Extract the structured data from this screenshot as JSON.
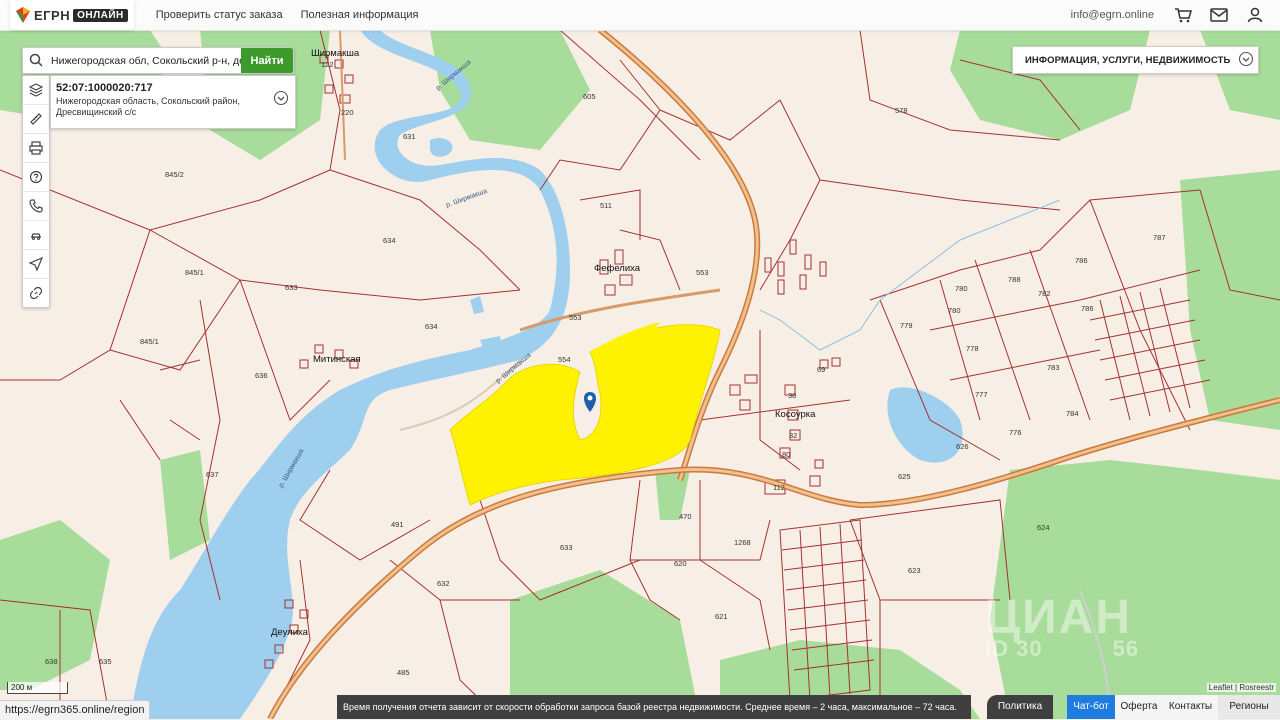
{
  "header": {
    "logo_text": "ЕГРН",
    "logo_badge": "ОНЛАЙН",
    "nav": [
      "Проверить статус заказа",
      "Полезная информация"
    ],
    "email": "info@egrn.online",
    "icons": [
      "cart-icon",
      "mail-icon",
      "user-icon"
    ]
  },
  "search": {
    "value": "Нижегородская обл, Сокольский р-н, дере",
    "button": "Найти"
  },
  "toolbar": [
    "layers-icon",
    "ruler-icon",
    "print-icon",
    "help-icon",
    "phone-icon",
    "auction-icon",
    "locate-icon",
    "link-icon"
  ],
  "parcel": {
    "cadastral_number": "52:07:1000020:717",
    "address_line1": "Нижегородская область, Сокольский район,",
    "address_line2": "Дресвищинский с/с"
  },
  "info_panel": {
    "label": "ИНФОРМАЦИЯ, УСЛУГИ, НЕДВИЖИМОСТЬ"
  },
  "map": {
    "places": [
      "Ширмакша",
      "Фефелиха",
      "Митинская",
      "Косоурка",
      "Деулиха"
    ],
    "rivers": [
      "р. Ширмакша",
      "р. Ширмакша",
      "р. Ширмакша",
      "р. Ширмакша"
    ],
    "plots": [
      "605",
      "578",
      "631",
      "122",
      "220",
      "845/2",
      "511",
      "634",
      "553",
      "845/1",
      "633",
      "634",
      "553",
      "554",
      "787",
      "786",
      "788",
      "780",
      "782",
      "786",
      "779",
      "778",
      "783",
      "780",
      "777",
      "784",
      "776",
      "636",
      "845/1",
      "626",
      "625",
      "637",
      "491",
      "633",
      "470",
      "1268",
      "620",
      "624",
      "623",
      "621",
      "632",
      "638",
      "635",
      "485",
      "112",
      "32",
      "38",
      "80",
      "69"
    ],
    "scale": "200 м",
    "attribution": "Leaflet | Rosreestr",
    "watermark": "ЦИАН",
    "watermark_id": "ID 30",
    "watermark_id2": "56",
    "colors": {
      "parcel_fill": "#fff200",
      "water": "#9fcfee",
      "forest": "#a8dc9a",
      "roads": "#e39a57",
      "borders": "#a43232"
    }
  },
  "footer": {
    "url": "https://egrn365.online/region",
    "note": "Время получения отчета зависит от скорости обработки запроса базой реестра недвижимости. Среднее время – 2 часа, максимальное – 72 часа.",
    "buttons": [
      "Политика",
      "Чат-бот",
      "Оферта",
      "Контакты",
      "Регионы"
    ]
  }
}
